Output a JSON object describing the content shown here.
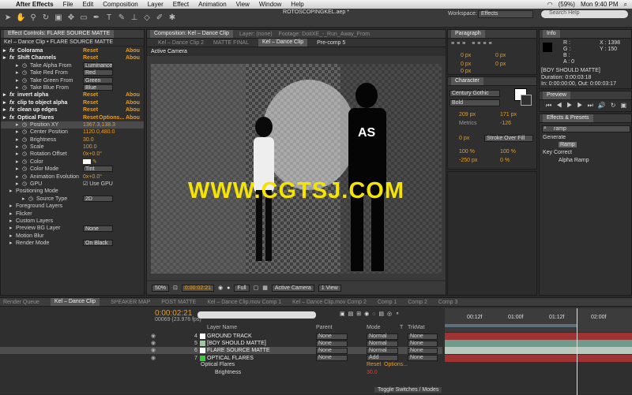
{
  "menubar": {
    "app": "After Effects",
    "items": [
      "File",
      "Edit",
      "Composition",
      "Layer",
      "Effect",
      "Animation",
      "View",
      "Window",
      "Help"
    ],
    "battery": "(59%)",
    "clock": "Mon 9:40 PM"
  },
  "toolbar": {
    "doc_title": "ROTOSCOPINGKEL.aep *",
    "workspace_label": "Workspace:",
    "workspace_value": "Effects",
    "search_placeholder": "Search Help"
  },
  "effect_controls": {
    "tab": "Effect Controls: FLARE SOURCE MATTE",
    "subtitle": "Kel – Dance Clip • FLARE SOURCE MATTE",
    "rows": [
      {
        "name": "Colorama",
        "reset": "Reset",
        "about": "Abou",
        "fx": true,
        "indent": 0
      },
      {
        "name": "Shift Channels",
        "reset": "Reset",
        "about": "Abou",
        "fx": true,
        "indent": 0
      },
      {
        "name": "Take Alpha From",
        "value": "Luminance",
        "dd": true,
        "indent": 2
      },
      {
        "name": "Take Red From",
        "value": "Red",
        "dd": true,
        "indent": 2
      },
      {
        "name": "Take Green From",
        "value": "Green",
        "dd": true,
        "indent": 2
      },
      {
        "name": "Take Blue From",
        "value": "Blue",
        "dd": true,
        "indent": 2
      },
      {
        "name": "invert alpha",
        "reset": "Reset",
        "about": "Abou",
        "fx": true,
        "indent": 0
      },
      {
        "name": "clip to object alpha",
        "reset": "Reset",
        "about": "Abou",
        "fx": true,
        "indent": 0
      },
      {
        "name": "clean up edges",
        "reset": "Reset",
        "about": "Abou",
        "fx": true,
        "indent": 0
      },
      {
        "name": "Optical Flares",
        "reset": "Reset",
        "options": "Options...",
        "about": "Abou",
        "fx": true,
        "indent": 0
      },
      {
        "name": "Position XY",
        "value": "1367.3,138.3",
        "indent": 2,
        "selected": true
      },
      {
        "name": "Center Position",
        "value": "1120.0,480.0",
        "indent": 2
      },
      {
        "name": "Brightness",
        "value": "30.0",
        "indent": 2
      },
      {
        "name": "Scale",
        "value": "100.0",
        "indent": 2
      },
      {
        "name": "Rotation Offset",
        "value": "0x+0.0°",
        "indent": 2
      },
      {
        "name": "Color",
        "swatch": true,
        "indent": 2
      },
      {
        "name": "Color Mode",
        "value": "Tint",
        "dd": true,
        "indent": 2
      },
      {
        "name": "Animation Evolution",
        "value": "0x+0.0°",
        "indent": 2
      },
      {
        "name": "GPU",
        "check": "Use GPU",
        "indent": 2
      },
      {
        "name": "Positioning Mode",
        "indent": 1
      },
      {
        "name": "Source Type",
        "value": "2D",
        "dd": true,
        "indent": 3
      },
      {
        "name": "Foreground Layers",
        "indent": 1
      },
      {
        "name": "Flicker",
        "indent": 1
      },
      {
        "name": "Custom Layers",
        "indent": 1
      },
      {
        "name": "Preview BG Layer",
        "value": "None",
        "dd": true,
        "indent": 1
      },
      {
        "name": "Motion Blur",
        "indent": 1
      },
      {
        "name": "Render Mode",
        "value": "On Black",
        "dd": true,
        "indent": 1
      }
    ]
  },
  "composition": {
    "tab": "Composition: Kel – Dance Clip",
    "layer_tab": "Layer: (none)",
    "footage_tab": "Footage: DoitXE_-_Run_Away_From",
    "breadcrumbs": [
      "Kel – Dance Clip 2",
      "MATTE FINAL",
      "Kel – Dance Clip",
      "Pre-comp 5"
    ],
    "view_label": "Active Camera",
    "watermark": "WWW.CGTSJ.COM",
    "zoom": "50%",
    "timecode": "0:00:02:21",
    "resolution": "Full",
    "camera": "Active Camera",
    "views": "1 View"
  },
  "paragraph": {
    "title": "Paragraph",
    "fields": [
      "0 px",
      "0 px",
      "0 px",
      "0 px",
      "0 px"
    ]
  },
  "character": {
    "title": "Character",
    "font": "Century Gothic",
    "style": "Bold",
    "size": "209 px",
    "leading": "171 px",
    "kerning": "Metrics",
    "tracking": "-126",
    "stroke_width": "0 px",
    "stroke_type": "Stroke Over Fill",
    "vscale": "100 %",
    "hscale": "100 %",
    "baseline": "-250 px",
    "tsume": "0 %"
  },
  "info": {
    "title": "Info",
    "x": "X : 1398",
    "y": "Y : 150",
    "r": "R :",
    "g": "G :",
    "b": "B :",
    "a": "A : 0",
    "layer": "[BOY SHOULD MATTE]",
    "duration": "Duration: 0:00:03:18",
    "inout": "In: 0:00:00:00, Out: 0:00:03:17"
  },
  "preview": {
    "title": "Preview"
  },
  "effects_presets": {
    "title": "Effects & Presets",
    "search_value": "ramp",
    "items": [
      {
        "label": "Generate",
        "indent": 0
      },
      {
        "label": "Ramp",
        "indent": 1
      },
      {
        "label": "Key Correct",
        "indent": 0
      },
      {
        "label": "Alpha Ramp",
        "indent": 1
      }
    ]
  },
  "timeline": {
    "tabs": [
      "Render Queue",
      "Kel – Dance Clip",
      "SPEAKER MAP",
      "POST MATTE",
      "Kel – Dance Clip.mov Comp 1",
      "Kel – Dance Clip.mov Comp 2",
      "Comp 1",
      "Comp 2",
      "Comp 3"
    ],
    "timecode": "0:00:02:21",
    "frame_info": "00069 (23.976 fps)",
    "col_layer": "Layer Name",
    "col_parent": "Parent",
    "col_mode": "Mode",
    "col_t": "T",
    "col_trkmat": "TrkMat",
    "ruler": [
      "00:12f",
      "01:00f",
      "01:12f",
      "02:00f"
    ],
    "layers": [
      {
        "index": "4",
        "name": "GROUND TRACK",
        "parent": "None",
        "mode": "Normal",
        "trkmat": "None",
        "chip": "#ffffff",
        "bar": "#9e3333"
      },
      {
        "index": "5",
        "name": "[BOY SHOULD MATTE]",
        "parent": "None",
        "mode": "Normal",
        "trkmat": "None",
        "chip": "#a0c8a0",
        "bar": "#6f9b8e"
      },
      {
        "index": "6",
        "name": "FLARE SOURCE MATTE",
        "parent": "None",
        "mode": "Normal",
        "trkmat": "None",
        "chip": "#ffffff",
        "bar": "#b9c9c0",
        "selected": true
      },
      {
        "index": "7",
        "name": "OPTICAL FLARES",
        "parent": "None",
        "mode": "Add",
        "trkmat": "None",
        "chip": "#33cc33",
        "bar": "#9e3333"
      }
    ],
    "sub_effect": "Optical Flares",
    "sub_reset": "Reset",
    "sub_options": "Options...",
    "sub_prop": "Brightness",
    "sub_value": "30.0",
    "toggle": "Toggle Switches / Modes"
  }
}
